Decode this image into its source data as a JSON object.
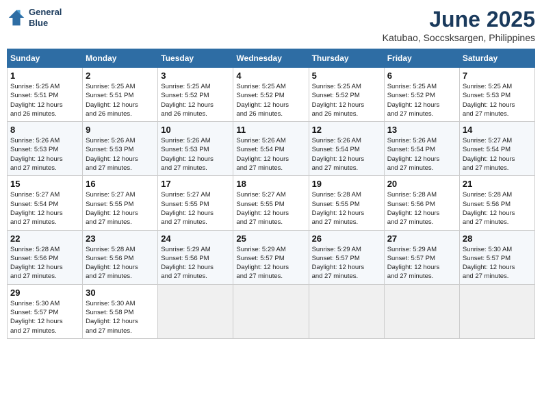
{
  "header": {
    "logo_line1": "General",
    "logo_line2": "Blue",
    "title": "June 2025",
    "subtitle": "Katubao, Soccsksargen, Philippines"
  },
  "calendar": {
    "days_of_week": [
      "Sunday",
      "Monday",
      "Tuesday",
      "Wednesday",
      "Thursday",
      "Friday",
      "Saturday"
    ],
    "weeks": [
      [
        {
          "num": "",
          "info": "",
          "empty": true
        },
        {
          "num": "2",
          "info": "Sunrise: 5:25 AM\nSunset: 5:51 PM\nDaylight: 12 hours\nand 26 minutes."
        },
        {
          "num": "3",
          "info": "Sunrise: 5:25 AM\nSunset: 5:52 PM\nDaylight: 12 hours\nand 26 minutes."
        },
        {
          "num": "4",
          "info": "Sunrise: 5:25 AM\nSunset: 5:52 PM\nDaylight: 12 hours\nand 26 minutes."
        },
        {
          "num": "5",
          "info": "Sunrise: 5:25 AM\nSunset: 5:52 PM\nDaylight: 12 hours\nand 26 minutes."
        },
        {
          "num": "6",
          "info": "Sunrise: 5:25 AM\nSunset: 5:52 PM\nDaylight: 12 hours\nand 27 minutes."
        },
        {
          "num": "7",
          "info": "Sunrise: 5:25 AM\nSunset: 5:53 PM\nDaylight: 12 hours\nand 27 minutes."
        }
      ],
      [
        {
          "num": "1",
          "info": "Sunrise: 5:25 AM\nSunset: 5:51 PM\nDaylight: 12 hours\nand 26 minutes."
        },
        {
          "num": "9",
          "info": "Sunrise: 5:26 AM\nSunset: 5:53 PM\nDaylight: 12 hours\nand 27 minutes."
        },
        {
          "num": "10",
          "info": "Sunrise: 5:26 AM\nSunset: 5:53 PM\nDaylight: 12 hours\nand 27 minutes."
        },
        {
          "num": "11",
          "info": "Sunrise: 5:26 AM\nSunset: 5:54 PM\nDaylight: 12 hours\nand 27 minutes."
        },
        {
          "num": "12",
          "info": "Sunrise: 5:26 AM\nSunset: 5:54 PM\nDaylight: 12 hours\nand 27 minutes."
        },
        {
          "num": "13",
          "info": "Sunrise: 5:26 AM\nSunset: 5:54 PM\nDaylight: 12 hours\nand 27 minutes."
        },
        {
          "num": "14",
          "info": "Sunrise: 5:27 AM\nSunset: 5:54 PM\nDaylight: 12 hours\nand 27 minutes."
        }
      ],
      [
        {
          "num": "8",
          "info": "Sunrise: 5:26 AM\nSunset: 5:53 PM\nDaylight: 12 hours\nand 27 minutes."
        },
        {
          "num": "16",
          "info": "Sunrise: 5:27 AM\nSunset: 5:55 PM\nDaylight: 12 hours\nand 27 minutes."
        },
        {
          "num": "17",
          "info": "Sunrise: 5:27 AM\nSunset: 5:55 PM\nDaylight: 12 hours\nand 27 minutes."
        },
        {
          "num": "18",
          "info": "Sunrise: 5:27 AM\nSunset: 5:55 PM\nDaylight: 12 hours\nand 27 minutes."
        },
        {
          "num": "19",
          "info": "Sunrise: 5:28 AM\nSunset: 5:55 PM\nDaylight: 12 hours\nand 27 minutes."
        },
        {
          "num": "20",
          "info": "Sunrise: 5:28 AM\nSunset: 5:56 PM\nDaylight: 12 hours\nand 27 minutes."
        },
        {
          "num": "21",
          "info": "Sunrise: 5:28 AM\nSunset: 5:56 PM\nDaylight: 12 hours\nand 27 minutes."
        }
      ],
      [
        {
          "num": "15",
          "info": "Sunrise: 5:27 AM\nSunset: 5:54 PM\nDaylight: 12 hours\nand 27 minutes."
        },
        {
          "num": "23",
          "info": "Sunrise: 5:28 AM\nSunset: 5:56 PM\nDaylight: 12 hours\nand 27 minutes."
        },
        {
          "num": "24",
          "info": "Sunrise: 5:29 AM\nSunset: 5:56 PM\nDaylight: 12 hours\nand 27 minutes."
        },
        {
          "num": "25",
          "info": "Sunrise: 5:29 AM\nSunset: 5:57 PM\nDaylight: 12 hours\nand 27 minutes."
        },
        {
          "num": "26",
          "info": "Sunrise: 5:29 AM\nSunset: 5:57 PM\nDaylight: 12 hours\nand 27 minutes."
        },
        {
          "num": "27",
          "info": "Sunrise: 5:29 AM\nSunset: 5:57 PM\nDaylight: 12 hours\nand 27 minutes."
        },
        {
          "num": "28",
          "info": "Sunrise: 5:30 AM\nSunset: 5:57 PM\nDaylight: 12 hours\nand 27 minutes."
        }
      ],
      [
        {
          "num": "22",
          "info": "Sunrise: 5:28 AM\nSunset: 5:56 PM\nDaylight: 12 hours\nand 27 minutes."
        },
        {
          "num": "30",
          "info": "Sunrise: 5:30 AM\nSunset: 5:58 PM\nDaylight: 12 hours\nand 27 minutes."
        },
        {
          "num": "",
          "info": "",
          "empty": true
        },
        {
          "num": "",
          "info": "",
          "empty": true
        },
        {
          "num": "",
          "info": "",
          "empty": true
        },
        {
          "num": "",
          "info": "",
          "empty": true
        },
        {
          "num": "",
          "info": "",
          "empty": true
        }
      ],
      [
        {
          "num": "29",
          "info": "Sunrise: 5:30 AM\nSunset: 5:57 PM\nDaylight: 12 hours\nand 27 minutes."
        },
        {
          "num": "",
          "info": "",
          "empty": true
        },
        {
          "num": "",
          "info": "",
          "empty": true
        },
        {
          "num": "",
          "info": "",
          "empty": true
        },
        {
          "num": "",
          "info": "",
          "empty": true
        },
        {
          "num": "",
          "info": "",
          "empty": true
        },
        {
          "num": "",
          "info": "",
          "empty": true
        }
      ]
    ]
  }
}
